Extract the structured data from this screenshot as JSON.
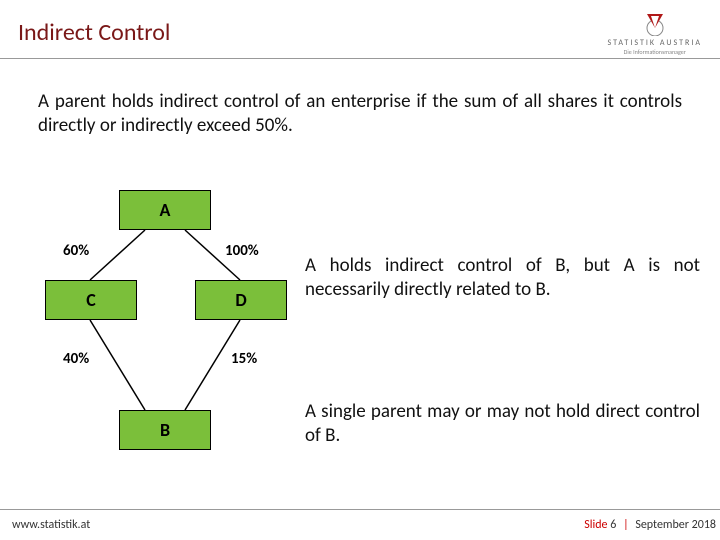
{
  "title": "Indirect Control",
  "logo": {
    "label": "STATISTIK AUSTRIA",
    "sub": "Die Informationsmanager"
  },
  "intro": "A parent holds indirect control of an enterprise if the sum of all shares it controls directly or indirectly exceed 50%.",
  "diagram": {
    "nodes": {
      "A": "A",
      "C": "C",
      "D": "D",
      "B": "B"
    },
    "edges": {
      "AC": "60%",
      "AD": "100%",
      "CB": "40%",
      "DB": "15%"
    }
  },
  "caption1": "A holds indirect control of B, but A is not necessarily directly related to B.",
  "caption2": "A single parent may or may not hold direct control of B.",
  "footer": {
    "url": "www.statistik.at",
    "slide_label": "Slide",
    "slide_num": "6",
    "date": "September 2018"
  }
}
